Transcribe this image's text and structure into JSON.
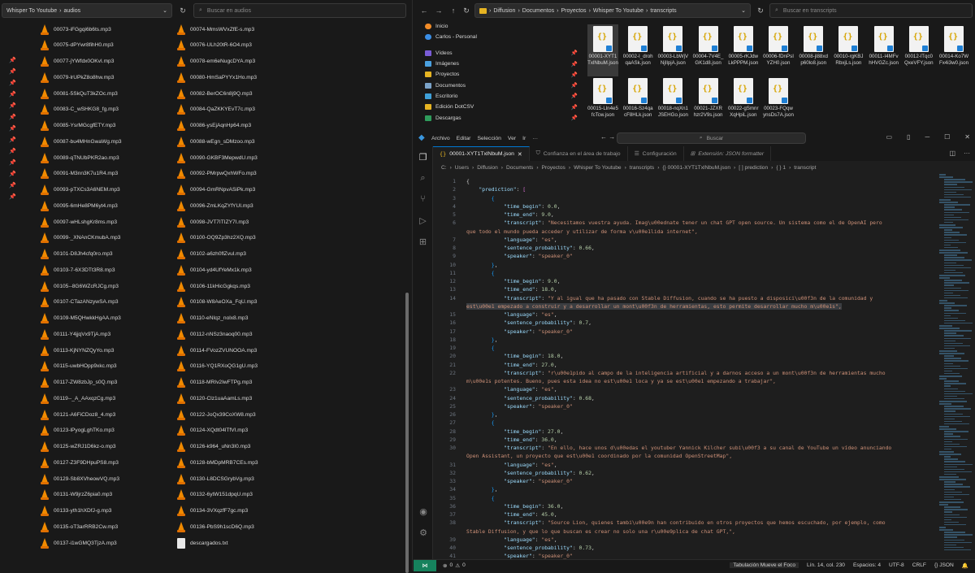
{
  "left_explorer": {
    "breadcrumb": [
      "Whisper To Youtube",
      "audios"
    ],
    "search_placeholder": "Buscar en audios",
    "files_col1": [
      "00073-iFGgqi6b6ts.mp3",
      "00075-dPYwr8fihH0.mp3",
      "00077-jYWfdx0OKvI.mp3",
      "00079-lrUPkZ8o8hw.mp3",
      "00081-5SkQuT3kZOc.mp3",
      "00083-C_wSHKG8_fg.mp3",
      "00085-YsrMGcgfETY.mp3",
      "00087-bu4MHnGwaWg.mp3",
      "00089-qTNUbPKR2ao.mp3",
      "00091-M3nn3K7u1R4.mp3",
      "00093-pTXCs3A6NEM.mp3",
      "00095-6mHe8PM6yt4.mp3",
      "00097-wHLshgKr8ms.mp3",
      "00099-_XNAnCKmubA.mp3",
      "00101-D8Jh4cfq0ro.mp3",
      "00103-7-6X3DTt3R8.mp3",
      "00105--8G6WZcRJCg.mp3",
      "00107-CTazANzywSA.mp3",
      "00109-M5QHwkkHgAA.mp3",
      "00111-Y4jjqVx9TjA.mp3",
      "00113-KjNYNZQyYo.mp3",
      "00115-uwbHOpp9xkc.mp3",
      "00117-ZW8zbJp_s0Q.mp3",
      "00119--_A_AAxqzCg.mp3",
      "00121-A6FiCDoz8_4.mp3",
      "00123-lPyogLghTKo.mp3",
      "00125-wZRJ1D6kz-o.mp3",
      "00127-Z3F9DHpuPS8.mp3",
      "00129-Sb8XVheowVQ.mp3",
      "00131-W9jrzZ6pia0.mp3",
      "00133-yth1hXDfJ-g.mp3",
      "00135-oT3arRRB2Cw.mp3",
      "00137-i1wGMQ3TjzA.mp3"
    ],
    "files_col2": [
      "00074-MmsWVxZfE-s.mp3",
      "00076-ULh20tR-6O4.mp3",
      "00078-em6eNugcDYA.mp3",
      "00080-HmSaPYYx1Ho.mp3",
      "00082-BerOC6n8j9Q.mp3",
      "00084-QaZKKYEvT7c.mp3",
      "00086-ysEjAqnHp64.mp3",
      "00088-wEgn_sDMzoo.mp3",
      "00090-GKBF3MepwdU.mp3",
      "00092-PMrpwQxhWFo.mp3",
      "00094-GmRNpvASiPk.mp3",
      "00096-ZmLKqZYfYUI.mp3",
      "00098-JVT7ITIZY7I.mp3",
      "00100-OQ9Zp3hz2XQ.mp3",
      "00102-a6zh0flZvul.mp3",
      "00104-yd4UfYeMx1k.mp3",
      "00106-11kHicGgkqs.mp3",
      "00108-W8AeOXa_FqU.mp3",
      "00110-eNIqz_nolx8.mp3",
      "00112-nNSz3naoq00.mp3",
      "00114-FVozZVUNOOA.mp3",
      "00116-YQ1RXoQG1gU.mp3",
      "00118-MRIv2IwFTPg.mp3",
      "00120-Clz1uaAamLs.mp3",
      "00122-JoQx39CoXW8.mp3",
      "00124-XQdt04lTfVI.mp3",
      "00126-k964_uNn3I0.mp3",
      "00128-bMDpMRB7CEs.mp3",
      "00130-L8DCSGrybVg.mp3",
      "00132-6ytW151dpqU.mp3",
      "00134-3VXqzfF7gc.mp3",
      "00136-PbS9h1scD6Q.mp3",
      "descargados.txt"
    ]
  },
  "right_explorer": {
    "breadcrumb": [
      "Diffusion",
      "Documentos",
      "Proyectos",
      "Whisper To Youtube",
      "transcripts"
    ],
    "search_placeholder": "Buscar en transcripts",
    "sidebar": [
      "Inicio",
      "Carlos - Personal",
      "Vídeos",
      "Imágenes",
      "Proyectos",
      "Documentos",
      "Escritorio",
      "Edición DotCSV",
      "Descargas"
    ],
    "sidebar_colors": [
      "#f28c28",
      "#3a8ee6",
      "#7a5cd6",
      "#4aa0e0",
      "#e6b422",
      "#7aa2c8",
      "#3fa0d8",
      "#e6b422",
      "#2f9c5c"
    ],
    "files": [
      "00001-XYT1TxlNbuM.json",
      "00002-I_drohqaASk.json",
      "00003-LbWjVNjIlpjA.json",
      "00004-7V4E_GK1d8.json",
      "00005-rKJdwLkPPPM.json",
      "00006-fDnPsIYZH0.json",
      "00008-jl88xdp60lo8.json",
      "00010-rgKBJRbxjLs.json",
      "00011-I4MFvhHVGZc.json",
      "00012-lTqc0QxeVFY.json",
      "00014-Ko7WFx4i3w0.json",
      "00015-Lln4e5fcTcw.json",
      "00016-Sz4qacF8HLk.json",
      "00018-nqXn1JSEHGo.json",
      "00021-JZXRhzr2V9s.json",
      "00022-gSmnrXqHpiL.json",
      "00023-FQqwynsDs7A.json"
    ]
  },
  "vscode": {
    "menu": [
      "Archivo",
      "Editar",
      "Selección",
      "Ver",
      "Ir",
      "···"
    ],
    "search_label": "Buscar",
    "tabs": [
      "00001-XYT1TxlNbuM.json",
      "Confianza en el área de trabajo",
      "Configuración",
      "Extensión: JSON formatter"
    ],
    "breadcrumb": [
      "C:",
      "Users",
      "Diffusion",
      "Documents",
      "Proyectos",
      "Whisper To Youtube",
      "transcripts",
      "{} 00001-XYT1TxlNbuM.json",
      "[ ] prediction",
      "{ } 1",
      "transcript"
    ],
    "status": {
      "focus": "Tabulación Mueve el Foco",
      "position": "Lín. 14, col. 230",
      "spaces": "Espacios: 4",
      "encoding": "UTF-8",
      "eol": "CRLF",
      "language": "JSON",
      "errors": "0",
      "warnings": "0"
    },
    "line_numbers": [
      "1",
      "2",
      "3",
      "4",
      "5",
      "6",
      "",
      "7",
      "8",
      "9",
      "10",
      "11",
      "12",
      "13",
      "14",
      "",
      "15",
      "16",
      "17",
      "18",
      "19",
      "20",
      "21",
      "22",
      "",
      "23",
      "24",
      "25",
      "26",
      "27",
      "28",
      "29",
      "30",
      "",
      "31",
      "32",
      "33",
      "34",
      "35",
      "36",
      "37",
      "38",
      "",
      "39",
      "40",
      "41",
      "42"
    ],
    "segments": [
      {
        "time_begin": "0.0",
        "time_end": "9.0",
        "transcript_a": "\"Necesitamos vuestra ayuda. Imag\\u00ednate tener un chat GPT open source. Un sistema como el de OpenAI pero",
        "transcript_b": "que todo el mundo pueda acceder y utilizar de forma v\\u00e1lida internet\",",
        "language": "\"es\"",
        "sentence_probability": "0.66",
        "speaker": "\"speaker_0\""
      },
      {
        "time_begin": "9.0",
        "time_end": "18.0",
        "transcript_a": "\"Y al igual que ha pasado con Stable Diffusion, cuando se ha puesto a disposici\\u00f3n de la comunidad y",
        "transcript_b": "est\\u00e1 empezado a construir y a desarrollar un mont\\u00f3n de herramientas, esto permite desarrollar mucho m\\u00e1s\",",
        "language": "\"es\"",
        "sentence_probability": "0.7",
        "speaker": "\"speaker_0\""
      },
      {
        "time_begin": "18.0",
        "time_end": "27.0",
        "transcript_a": "\"r\\u00e1pido al campo de la inteligencia artificial y a darnos acceso a un mont\\u00f3n de herramientas mucho",
        "transcript_b": "m\\u00e1s potentes. Bueno, pues esta idea no est\\u00e1 loca y ya se est\\u00e1 empezando a trabajar\",",
        "language": "\"es\"",
        "sentence_probability": "0.68",
        "speaker": "\"speaker_0\""
      },
      {
        "time_begin": "27.0",
        "time_end": "36.0",
        "transcript_a": "\"En ello, hace unos d\\u00edas el youtuber Yannick Kilcher subi\\u00f3 a su canal de YouTube un vídeo anunciando",
        "transcript_b": "Open Assistant, un proyecto que est\\u00e1 coordinado por la comunidad OpenStreetMap\",",
        "language": "\"es\"",
        "sentence_probability": "0.62",
        "speaker": "\"speaker_0\""
      },
      {
        "time_begin": "36.0",
        "time_end": "45.0",
        "transcript_a": "\"Source Lion, quienes tambi\\u00e9n han contribuido en otros proyectos que hemos escuchado, por ejemplo, como",
        "transcript_b": "Stable Diffusion, y que lo que buscan es crear no solo una r\\u00e9plica de chat GPT,\",",
        "language": "\"es\"",
        "sentence_probability": "0.73",
        "speaker": "\"speaker_0\""
      }
    ]
  }
}
